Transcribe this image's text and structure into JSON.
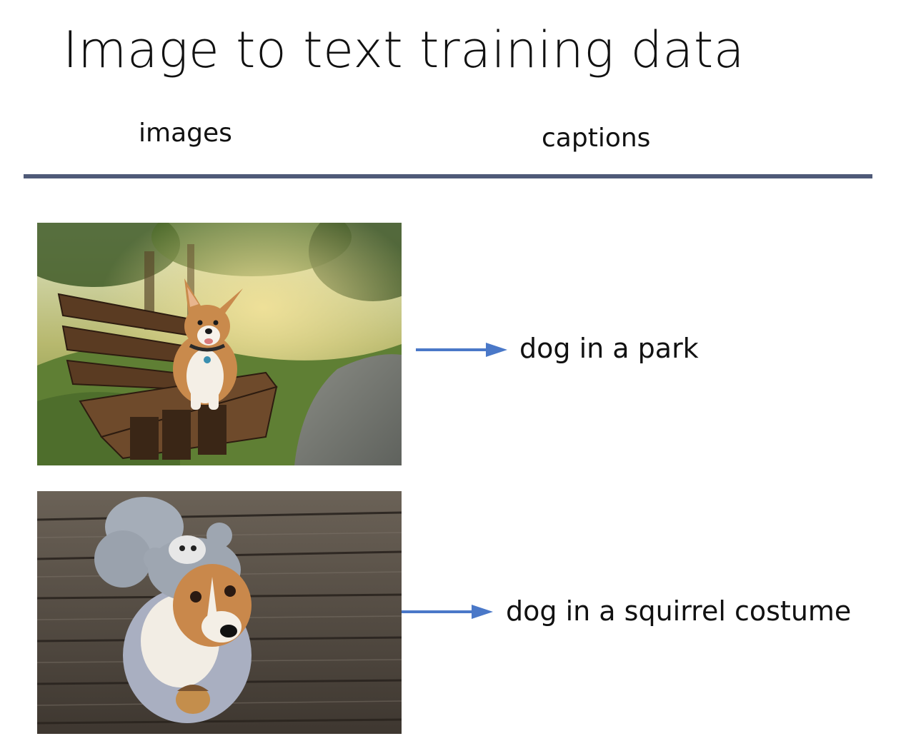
{
  "title": "Image to text training data",
  "columns": {
    "images": "images",
    "captions": "captions"
  },
  "rows": [
    {
      "caption": "dog in a park"
    },
    {
      "caption": "dog in a squirrel costume"
    }
  ],
  "colors": {
    "rule": "#4f5a78",
    "arrow": "#4a78c8"
  }
}
